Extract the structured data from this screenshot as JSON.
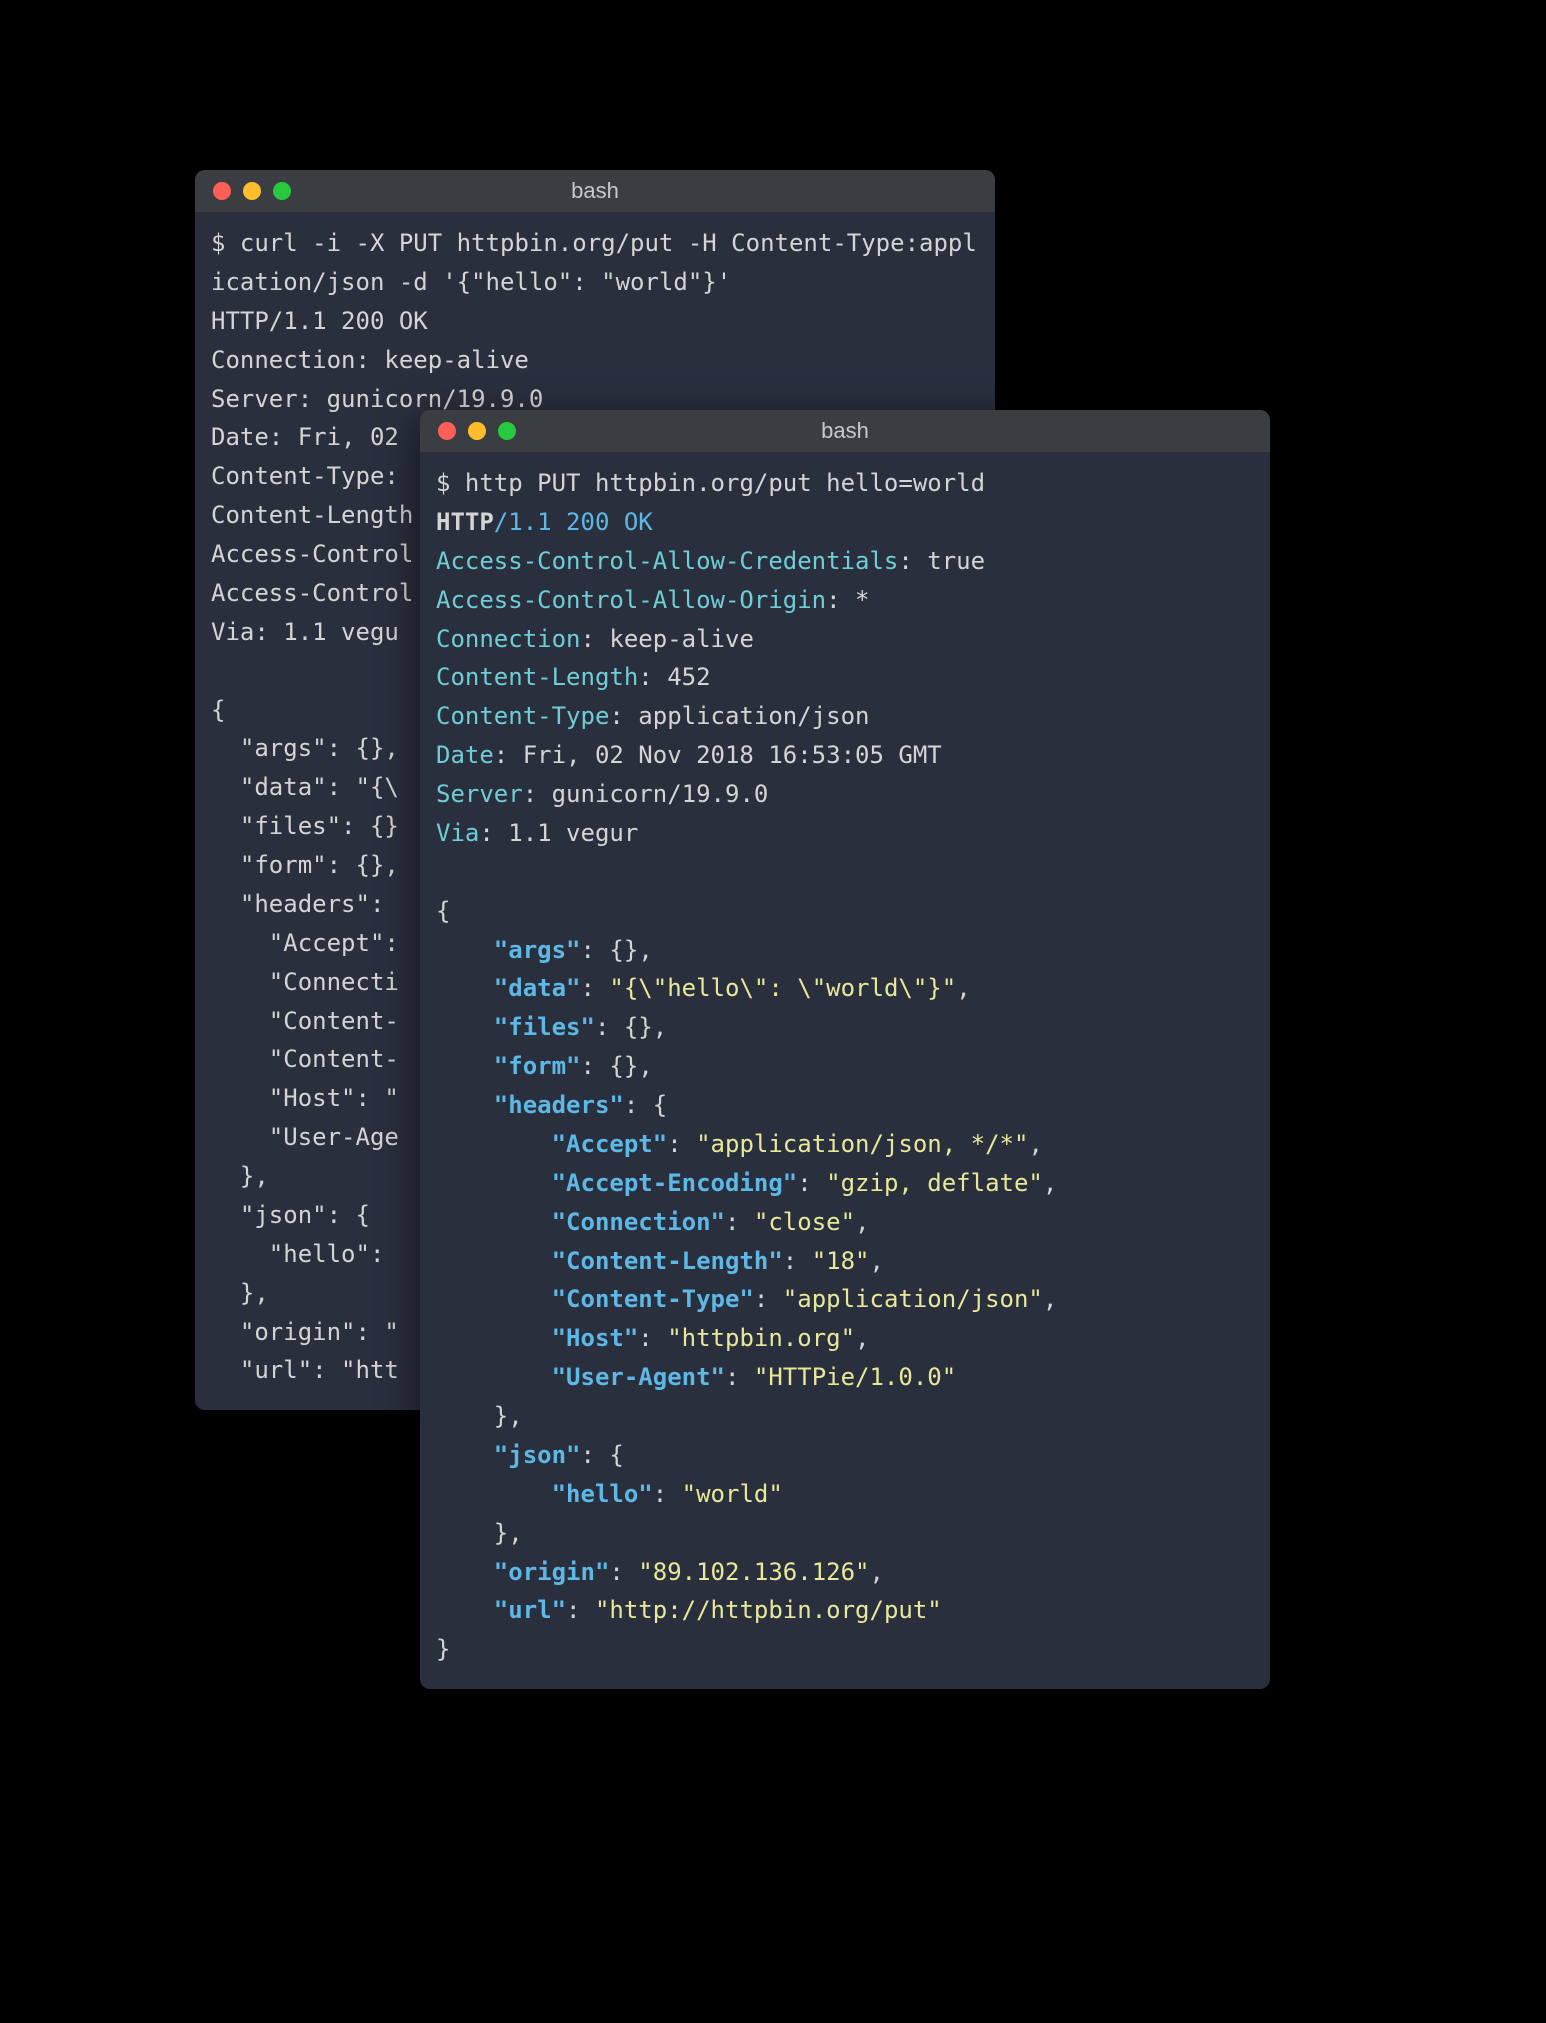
{
  "back": {
    "title": "bash",
    "prompt": "$",
    "command": "curl -i -X PUT httpbin.org/put -H Content-Type:application/json -d '{\"hello\": \"world\"}'",
    "response_lines": [
      "HTTP/1.1 200 OK",
      "Connection: keep-alive",
      "Server: gunicorn/19.9.0",
      "Date: Fri, 02 ",
      "Content-Type: ",
      "Content-Length",
      "Access-Control",
      "Access-Control",
      "Via: 1.1 vegu",
      "",
      "{",
      "  \"args\": {},",
      "  \"data\": \"{\\",
      "  \"files\": {}",
      "  \"form\": {},",
      "  \"headers\": ",
      "    \"Accept\": ",
      "    \"Connecti",
      "    \"Content-",
      "    \"Content-",
      "    \"Host\": \"",
      "    \"User-Age",
      "  },",
      "  \"json\": {",
      "    \"hello\": ",
      "  },",
      "  \"origin\": \"",
      "  \"url\": \"htt"
    ]
  },
  "front": {
    "title": "bash",
    "prompt": "$",
    "command": "http PUT httpbin.org/put hello=world",
    "status": {
      "proto": "HTTP",
      "rest": "/1.1 200 OK"
    },
    "headers": [
      {
        "name": "Access-Control-Allow-Credentials",
        "value": "true"
      },
      {
        "name": "Access-Control-Allow-Origin",
        "value": "*"
      },
      {
        "name": "Connection",
        "value": "keep-alive"
      },
      {
        "name": "Content-Length",
        "value": "452"
      },
      {
        "name": "Content-Type",
        "value": "application/json"
      },
      {
        "name": "Date",
        "value": "Fri, 02 Nov 2018 16:53:05 GMT"
      },
      {
        "name": "Server",
        "value": "gunicorn/19.9.0"
      },
      {
        "name": "Via",
        "value": "1.1 vegur"
      }
    ],
    "json_body": {
      "args_label": "\"args\"",
      "args_val": "{}",
      "data_label": "\"data\"",
      "data_val": "\"{\\\"hello\\\": \\\"world\\\"}\"",
      "files_label": "\"files\"",
      "files_val": "{}",
      "form_label": "\"form\"",
      "form_val": "{}",
      "headers_label": "\"headers\"",
      "h_accept_k": "\"Accept\"",
      "h_accept_v": "\"application/json, */*\"",
      "h_ae_k": "\"Accept-Encoding\"",
      "h_ae_v": "\"gzip, deflate\"",
      "h_conn_k": "\"Connection\"",
      "h_conn_v": "\"close\"",
      "h_cl_k": "\"Content-Length\"",
      "h_cl_v": "\"18\"",
      "h_ct_k": "\"Content-Type\"",
      "h_ct_v": "\"application/json\"",
      "h_host_k": "\"Host\"",
      "h_host_v": "\"httpbin.org\"",
      "h_ua_k": "\"User-Agent\"",
      "h_ua_v": "\"HTTPie/1.0.0\"",
      "json_label": "\"json\"",
      "json_hello_k": "\"hello\"",
      "json_hello_v": "\"world\"",
      "origin_label": "\"origin\"",
      "origin_val": "\"89.102.136.126\"",
      "url_label": "\"url\"",
      "url_val": "\"http://httpbin.org/put\""
    }
  }
}
